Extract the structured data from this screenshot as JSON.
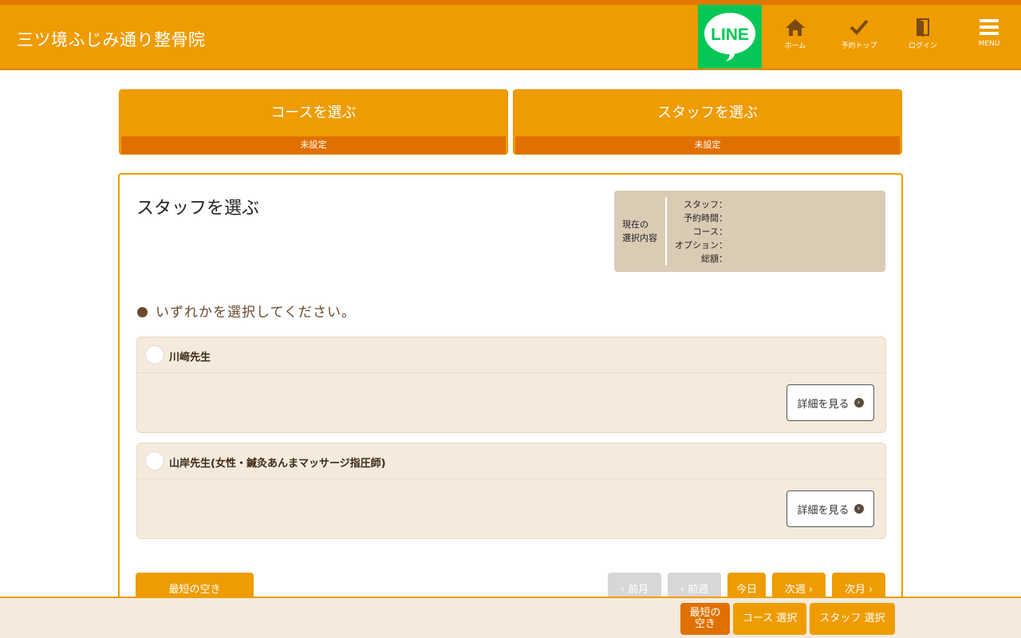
{
  "header": {
    "title": "三ツ境ふじみ通り整骨院",
    "line_label": "LINE",
    "nav": [
      {
        "label": "ホーム",
        "icon": "home-icon"
      },
      {
        "label": "予約トップ",
        "icon": "check-icon"
      },
      {
        "label": "ログイン",
        "icon": "door-icon"
      },
      {
        "label": "MENU",
        "icon": "hamburger-icon"
      }
    ]
  },
  "steps": [
    {
      "title": "コースを選ぶ",
      "status": "未設定"
    },
    {
      "title": "スタッフを選ぶ",
      "status": "未設定"
    }
  ],
  "panel": {
    "title": "スタッフを選ぶ",
    "summary": {
      "label": "現在の\n選択内容",
      "rows": [
        "スタッフ：",
        "予約時間：",
        "コース：",
        "オプション：",
        "総額："
      ]
    },
    "instruction": "いずれかを選択してください。",
    "staff": [
      {
        "name": "川﨑先生",
        "detail_label": "詳細を見る"
      },
      {
        "name": "山岸先生(女性・鍼灸あんまマッサージ指圧師)",
        "detail_label": "詳細を見る"
      }
    ],
    "earliest_label": "最短の空き",
    "date_nav": {
      "prev_month": "前月",
      "prev_week": "前週",
      "today": "今日",
      "next_week": "次週",
      "next_month": "次月"
    }
  },
  "bottom": {
    "earliest": "最短の\n空き",
    "course_select": "コース 選択",
    "staff_select": "スタッフ 選択"
  },
  "colors": {
    "brand_orange": "#ee9c00",
    "dark_orange": "#e07000",
    "line_green": "#06c755",
    "panel_bg": "#f5eadb"
  }
}
